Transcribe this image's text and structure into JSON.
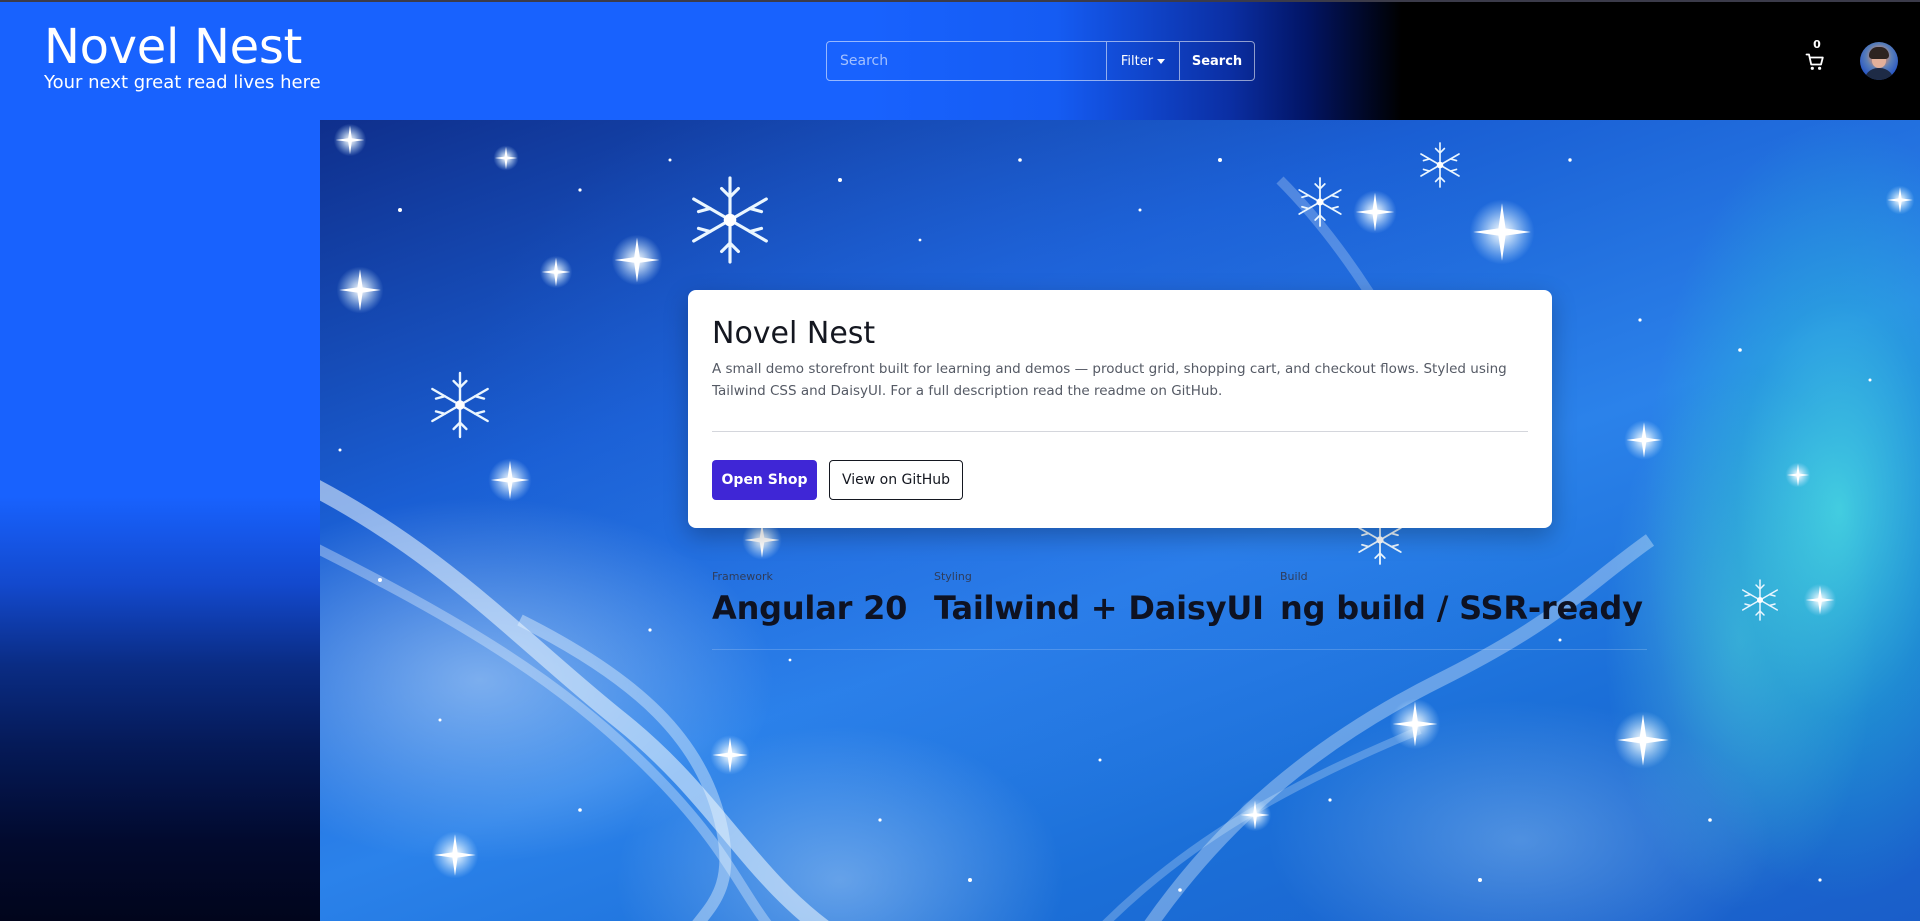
{
  "header": {
    "brand_title": "Novel Nest",
    "brand_tagline": "Your next great read lives here",
    "search": {
      "placeholder": "Search",
      "value": ""
    },
    "filter_label": "Filter",
    "search_button_label": "Search",
    "cart_count": "0",
    "cart_icon": "cart-icon",
    "avatar_icon": "user-avatar"
  },
  "hero": {
    "card": {
      "title": "Novel Nest",
      "description": "A small demo storefront built for learning and demos — product grid, shopping cart, and checkout flows. Styled using Tailwind CSS and DaisyUI. For a full description read the readme on GitHub.",
      "primary_button": "Open Shop",
      "secondary_button": "View on GitHub"
    },
    "stats": [
      {
        "label": "Framework",
        "value": "Angular 20"
      },
      {
        "label": "Styling",
        "value": "Tailwind + DaisyUI"
      },
      {
        "label": "Build",
        "value": "ng build / SSR-ready"
      }
    ]
  },
  "colors": {
    "brand_blue": "#1862fe",
    "primary_button": "#3f26d6",
    "aurora_teal": "#55ffe1"
  }
}
